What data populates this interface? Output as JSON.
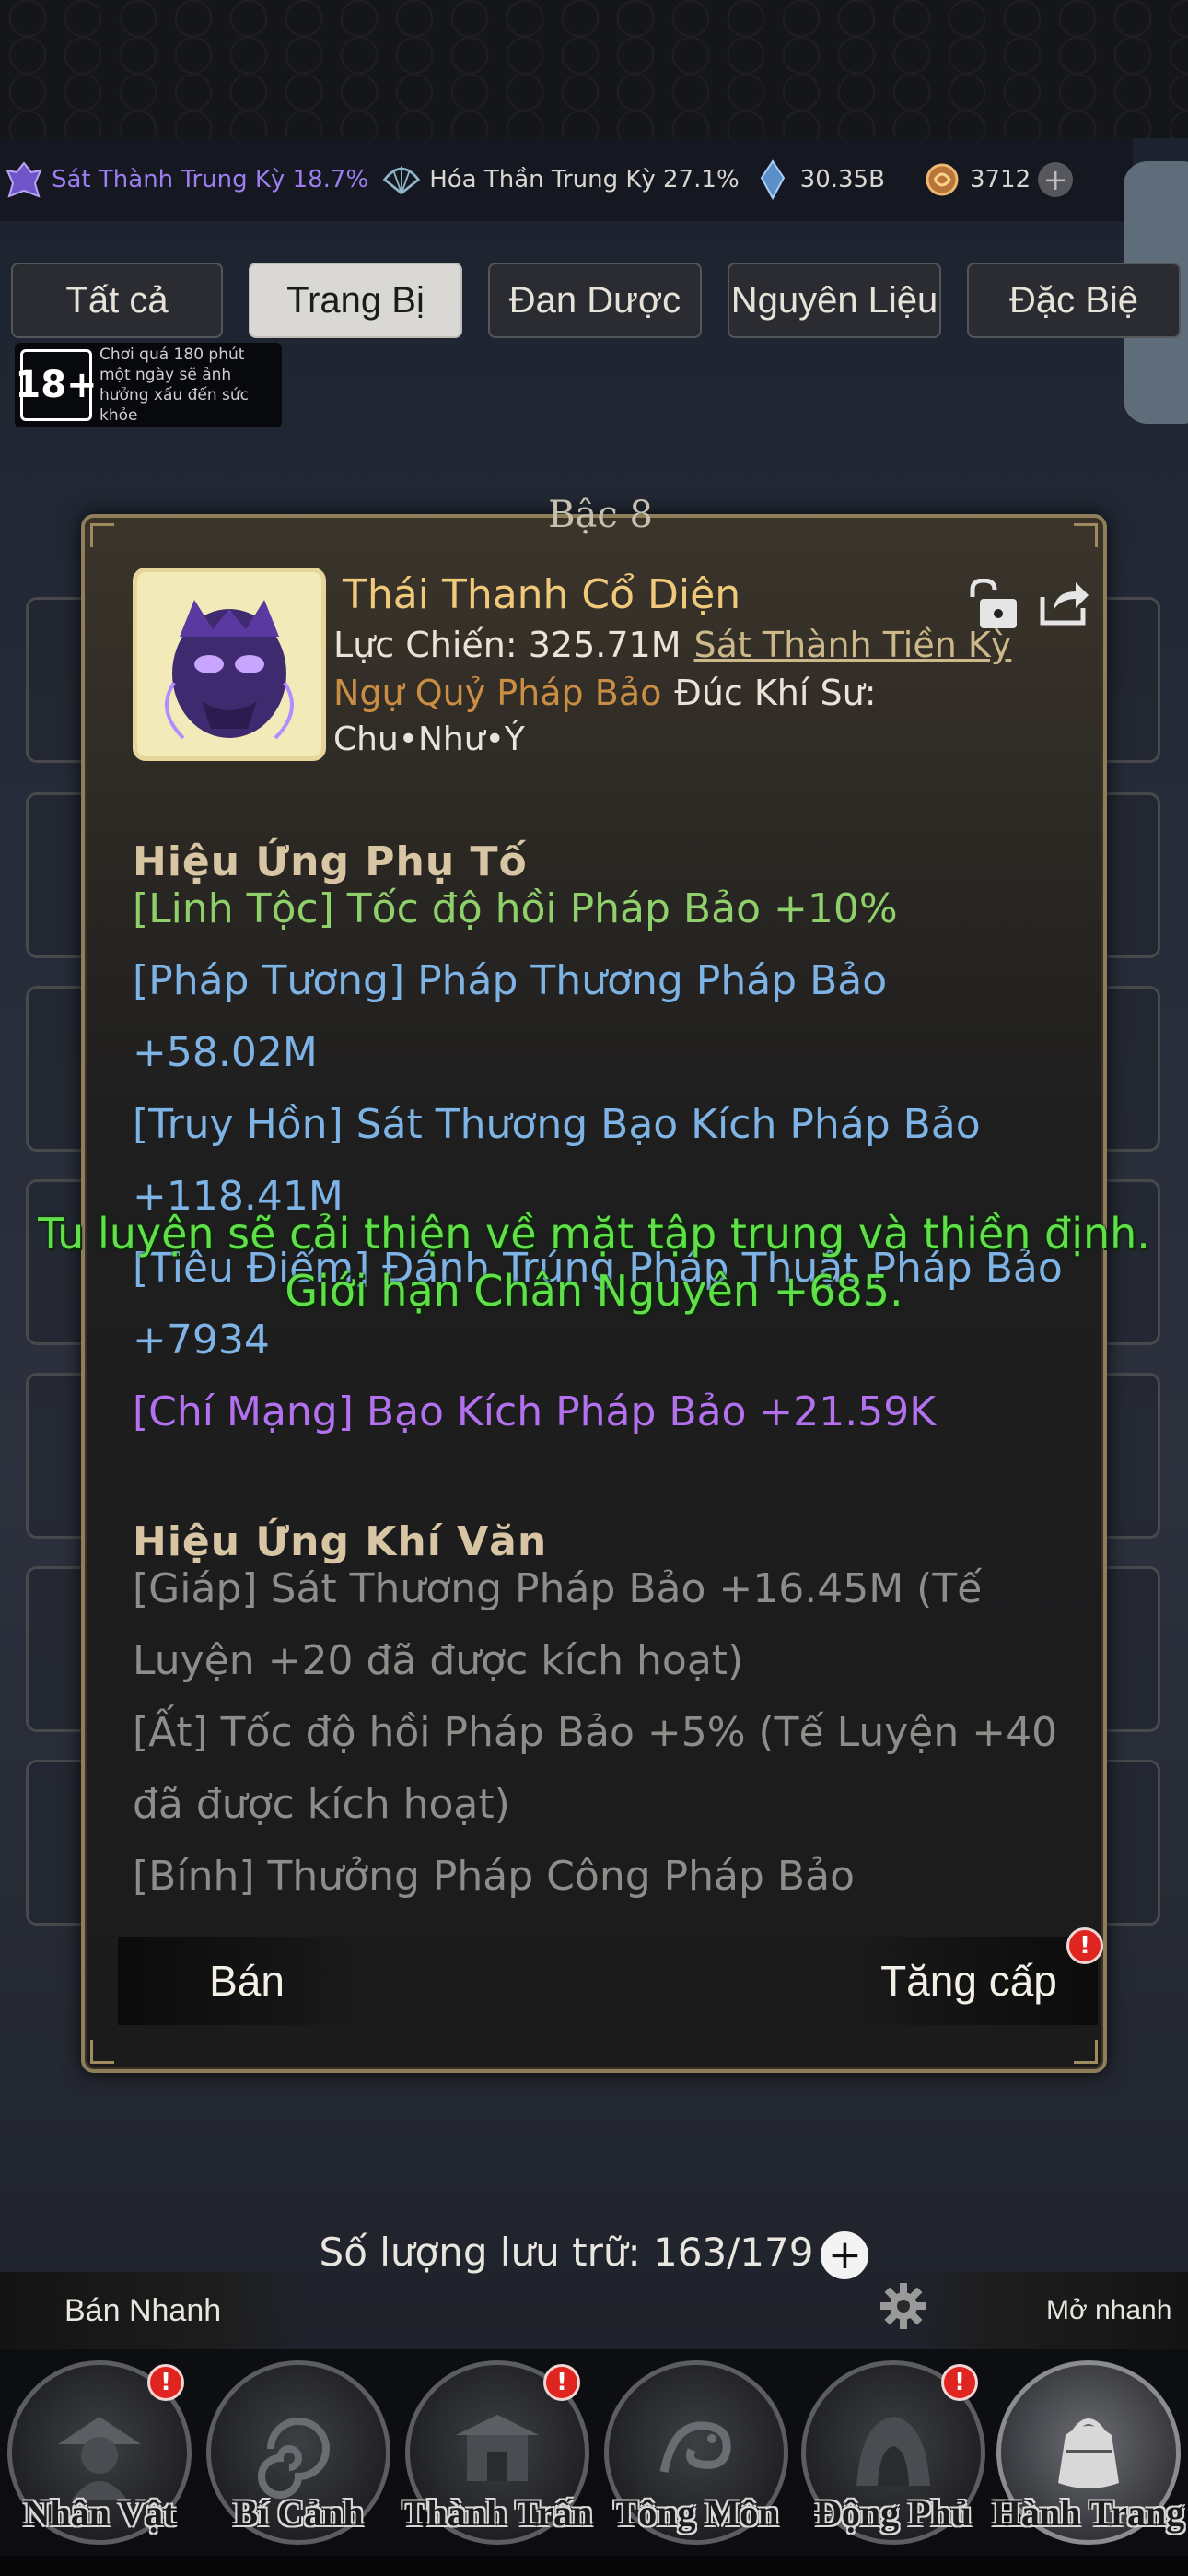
{
  "resources": [
    {
      "icon": "realm-emblem-icon",
      "label": "Sát Thành Trung Kỳ 18.7%",
      "color": "#9c7ef0"
    },
    {
      "icon": "fan-icon",
      "label": "Hóa Thần Trung Kỳ 27.1%",
      "color": "#d9d6d0"
    },
    {
      "icon": "spirit-crystal-icon",
      "label": "30.35B",
      "color": "#d9d6d0"
    },
    {
      "icon": "coin-icon",
      "label": "3712",
      "color": "#d9d6d0"
    }
  ],
  "side_handle_glyph": "❬",
  "tabs": [
    "Tất cả",
    "Trang Bị",
    "Đan Dược",
    "Nguyên Liệu",
    "Đặc Biệ"
  ],
  "active_tab": "Trang Bị",
  "age_notice": {
    "badge": "18+",
    "text": "Chơi quá 180 phút một ngày sẽ ảnh hưởng xấu đến sức khỏe"
  },
  "rank_title": "Bậc 8",
  "item": {
    "name": "Thái Thanh Cổ Diện",
    "power_label": "Lực Chiến: 325.71M",
    "realm": "Sát Thành Tiền Kỳ",
    "type": "Ngự Quỷ Pháp Bảo",
    "maker_label": "Đúc Khí Sư:",
    "maker_name": "Chu•Như•Ý"
  },
  "affix_section": "Hiệu Ứng Phụ Tố",
  "affixes": [
    {
      "text": "[Linh Tộc] Tốc độ hồi Pháp Bảo +10%",
      "color": "green"
    },
    {
      "text": "[Pháp Tương] Pháp Thương Pháp Bảo +58.02M",
      "color": "blue"
    },
    {
      "text": "[Truy Hồn] Sát Thương Bạo Kích Pháp Bảo +118.41M",
      "color": "blue"
    },
    {
      "text": "[Tiêu Điểm] Đánh Trúng Pháp Thuật Pháp Bảo +7934",
      "color": "blue"
    },
    {
      "text": "[Chí Mạng] Bạo Kích Pháp Bảo +21.59K",
      "color": "purple"
    }
  ],
  "inscription_section": "Hiệu Ứng Khí Văn",
  "inscriptions": [
    "[Giáp] Sát Thương Pháp Bảo +16.45M (Tế Luyện +20 đã được kích hoạt)",
    "[Ất] Tốc độ hồi Pháp Bảo +5% (Tế Luyện +40 đã được kích hoạt)",
    "[Bính] Thưởng Pháp Công Pháp Bảo"
  ],
  "buttons": {
    "sell": "Bán",
    "upgrade": "Tăng cấp",
    "badge": "!"
  },
  "toast": "Tu luyện sẽ cải thiện về mặt tập trung và thiền định. Giới hạn Chân Nguyên +685.",
  "storage": {
    "label": "Số lượng lưu trữ: 163/179",
    "plus": "+"
  },
  "quick": {
    "sell": "Bán Nhanh",
    "open": "Mở nhanh"
  },
  "nav": [
    {
      "label": "Nhân Vật",
      "badge": true
    },
    {
      "label": "Bí Cảnh",
      "badge": false
    },
    {
      "label": "Thành Trấn",
      "badge": true
    },
    {
      "label": "Tông Môn",
      "badge": false
    },
    {
      "label": "Động Phủ",
      "badge": true
    },
    {
      "label": "Hành Trang",
      "badge": false
    }
  ],
  "nav_badge": "!"
}
